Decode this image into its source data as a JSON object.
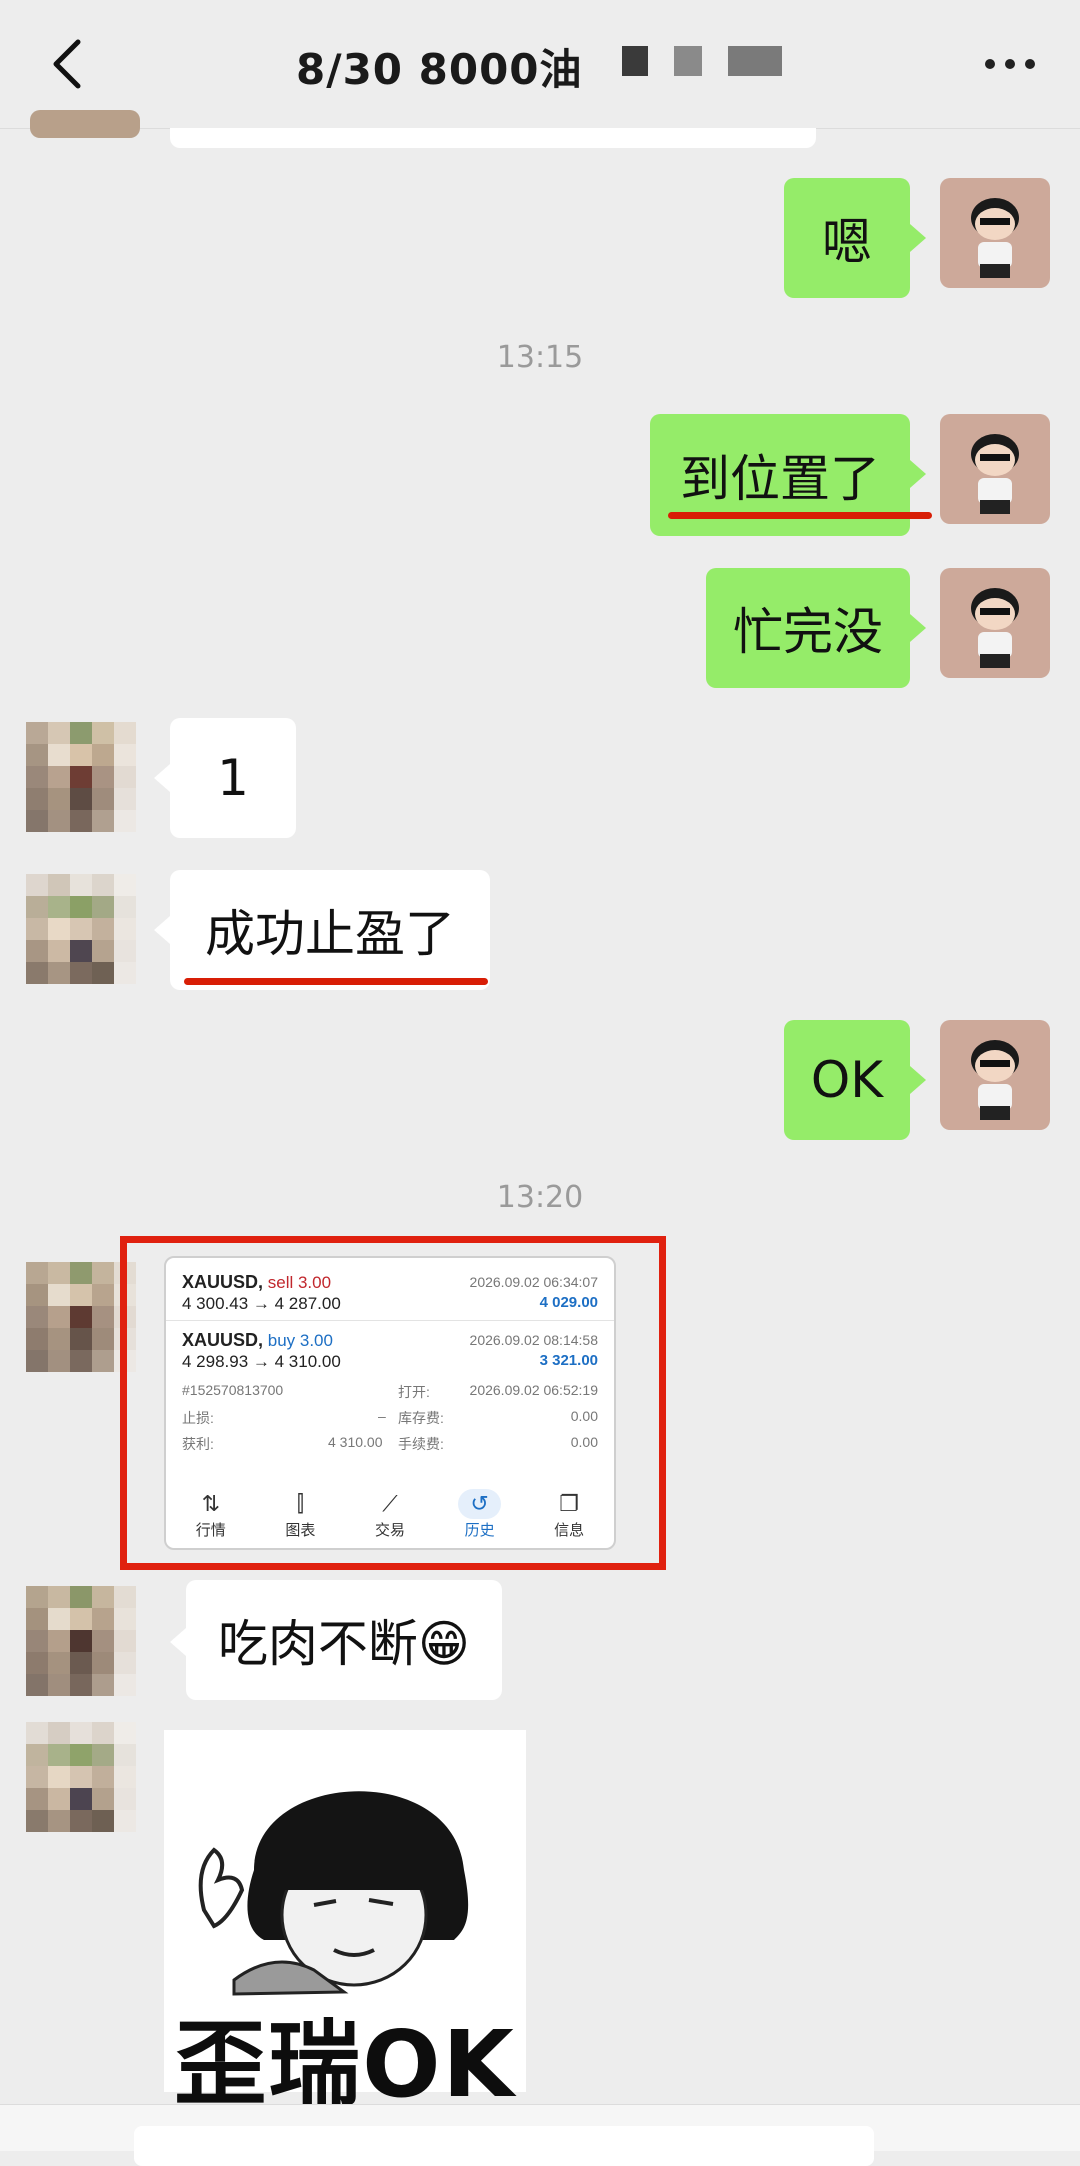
{
  "header": {
    "title": "8/30  8000油"
  },
  "messages": {
    "m1": "嗯",
    "time1": "13:15",
    "m2": "到位置了",
    "m3": "忙完没",
    "m4": "1",
    "m5": "成功止盈了",
    "m6": "OK",
    "time2": "13:20",
    "m7": "吃肉不断😁",
    "sticker_text": "歪瑞OK"
  },
  "trade": {
    "t1": {
      "symbol": "XAUUSD,",
      "side": "sell 3.00",
      "prices": "4 300.43 → 4 287.00",
      "date": "2026.09.02 06:34:07",
      "profit": "4 029.00"
    },
    "t2": {
      "symbol": "XAUUSD,",
      "side": "buy 3.00",
      "prices": "4 298.93 → 4 310.00",
      "date": "2026.09.02 08:14:58",
      "profit": "3 321.00"
    },
    "detail": {
      "order_id": "#152570813700",
      "open_label": "打开:",
      "open_value": "2026.09.02 06:52:19",
      "sl_label": "止损:",
      "sl_value": "–",
      "swap_label": "库存费:",
      "swap_value": "0.00",
      "tp_label": "获利:",
      "tp_value": "4 310.00",
      "fee_label": "手续费:",
      "fee_value": "0.00"
    },
    "nav": [
      "行情",
      "图表",
      "交易",
      "历史",
      "信息"
    ]
  },
  "colors": {
    "green_bubble": "#95ec69",
    "red_mark": "#e0210f",
    "blue": "#1d6fc4"
  }
}
